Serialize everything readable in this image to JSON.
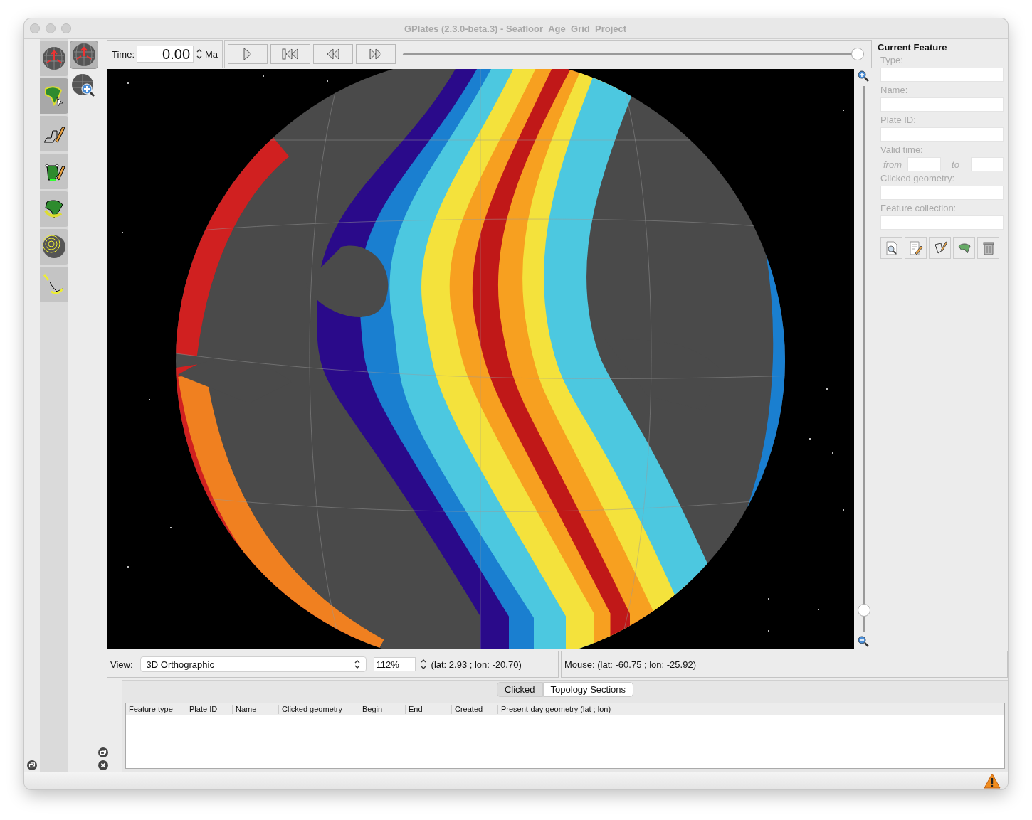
{
  "window": {
    "title": "GPlates (2.3.0-beta.3) - Seafloor_Age_Grid_Project"
  },
  "tool_palette": {
    "column_1": [
      {
        "kind": "globe-arrows",
        "selected": false
      },
      {
        "kind": "africa-cursor",
        "selected": true
      },
      {
        "kind": "polyline-pencil",
        "selected": false
      },
      {
        "kind": "shape-edit",
        "selected": false
      },
      {
        "kind": "africa-rotate",
        "selected": false
      },
      {
        "kind": "globe-rings",
        "selected": false
      },
      {
        "kind": "path-arrow",
        "selected": false
      }
    ],
    "column_2": [
      {
        "kind": "globe-arrows",
        "selected": true
      },
      {
        "kind": "globe-zoom",
        "selected": false
      }
    ]
  },
  "time_bar": {
    "label": "Time:",
    "value": "0.00",
    "unit": "Ma",
    "slider": {
      "level": 1.0
    }
  },
  "zoom_slider": {
    "level": 0.03
  },
  "current_feature": {
    "title": "Current Feature",
    "fields": [
      {
        "label": "Type:"
      },
      {
        "label": "Name:"
      },
      {
        "label": "Plate ID:"
      }
    ],
    "valid_time": {
      "label": "Valid time:",
      "from": "from",
      "to": "to"
    },
    "fields_after": [
      {
        "label": "Clicked geometry:"
      },
      {
        "label": "Feature collection:"
      }
    ]
  },
  "view_bar": {
    "label": "View:",
    "projection": "3D Orthographic",
    "zoom": "112%",
    "centre": "(lat: 2.93 ; lon: -20.70)",
    "mouse": "Mouse: (lat: -60.75 ; lon: -25.92)"
  },
  "tabs": [
    {
      "label": "Clicked",
      "selected": true
    },
    {
      "label": "Topology Sections",
      "selected": false
    }
  ],
  "table": {
    "columns": [
      "Feature type",
      "Plate ID",
      "Name",
      "Clicked geometry",
      "Begin",
      "End",
      "Created",
      "Present-day geometry (lat ; lon)"
    ]
  }
}
